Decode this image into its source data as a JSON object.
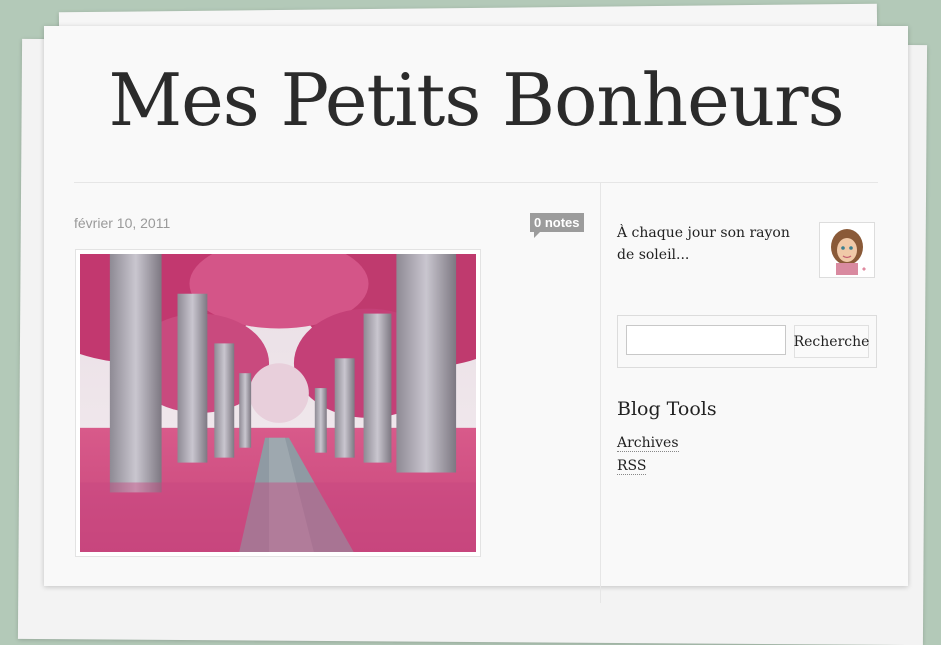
{
  "blog": {
    "title": "Mes Petits Bonheurs"
  },
  "post": {
    "date": "février 10, 2011",
    "notes_label": "0 notes"
  },
  "sidebar": {
    "bio": "À chaque jour son rayon de soleil...",
    "search": {
      "placeholder": "",
      "button_label": "Recherche"
    },
    "tools": {
      "title": "Blog Tools",
      "links": [
        {
          "label": "Archives"
        },
        {
          "label": "RSS"
        }
      ]
    }
  },
  "colors": {
    "background": "#b3c9b8",
    "paper": "#f9f9f9",
    "badge": "#9c9c9c",
    "text": "#222222"
  }
}
